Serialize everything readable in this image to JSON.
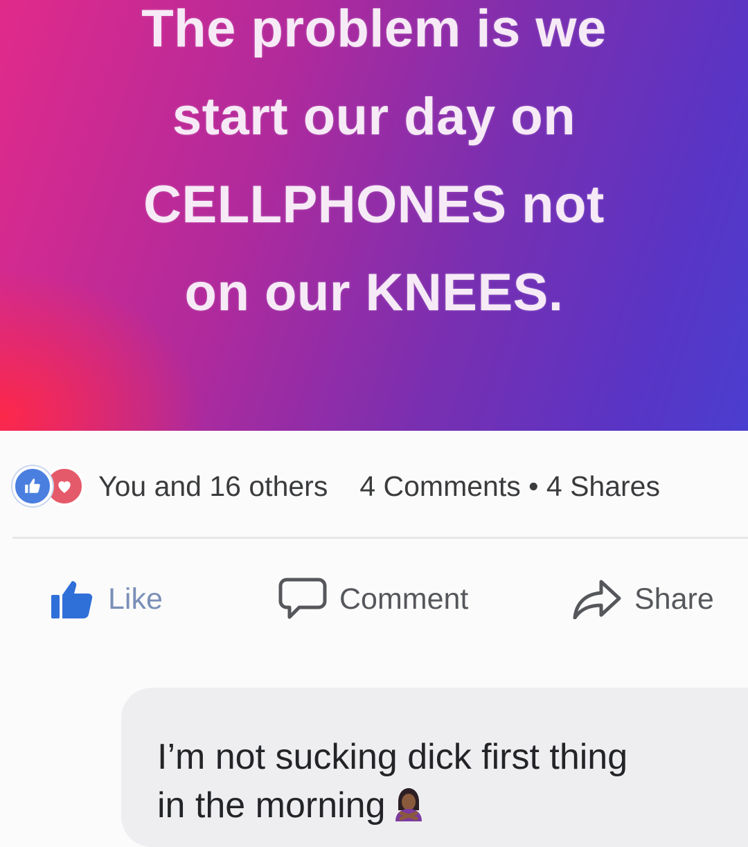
{
  "post": {
    "text_lines": [
      "The problem is we",
      "start our day on",
      "CELLPHONES not",
      "on our KNEES."
    ],
    "gradient_colors": [
      "#ff2846",
      "#e12a8a",
      "#7a2fb0",
      "#4a3ed0"
    ]
  },
  "reactions": {
    "icons": [
      "like-reaction-icon",
      "love-reaction-icon"
    ],
    "summary": "You and 16 others",
    "stats": "4 Comments • 4 Shares"
  },
  "actions": {
    "like_label": "Like",
    "comment_label": "Comment",
    "share_label": "Share",
    "like_color": "#4a7fe0"
  },
  "comment": {
    "line1": "I’m not sucking dick first thing",
    "line2": "in the morning",
    "emoji": "person-gesturing-no-emoji"
  }
}
